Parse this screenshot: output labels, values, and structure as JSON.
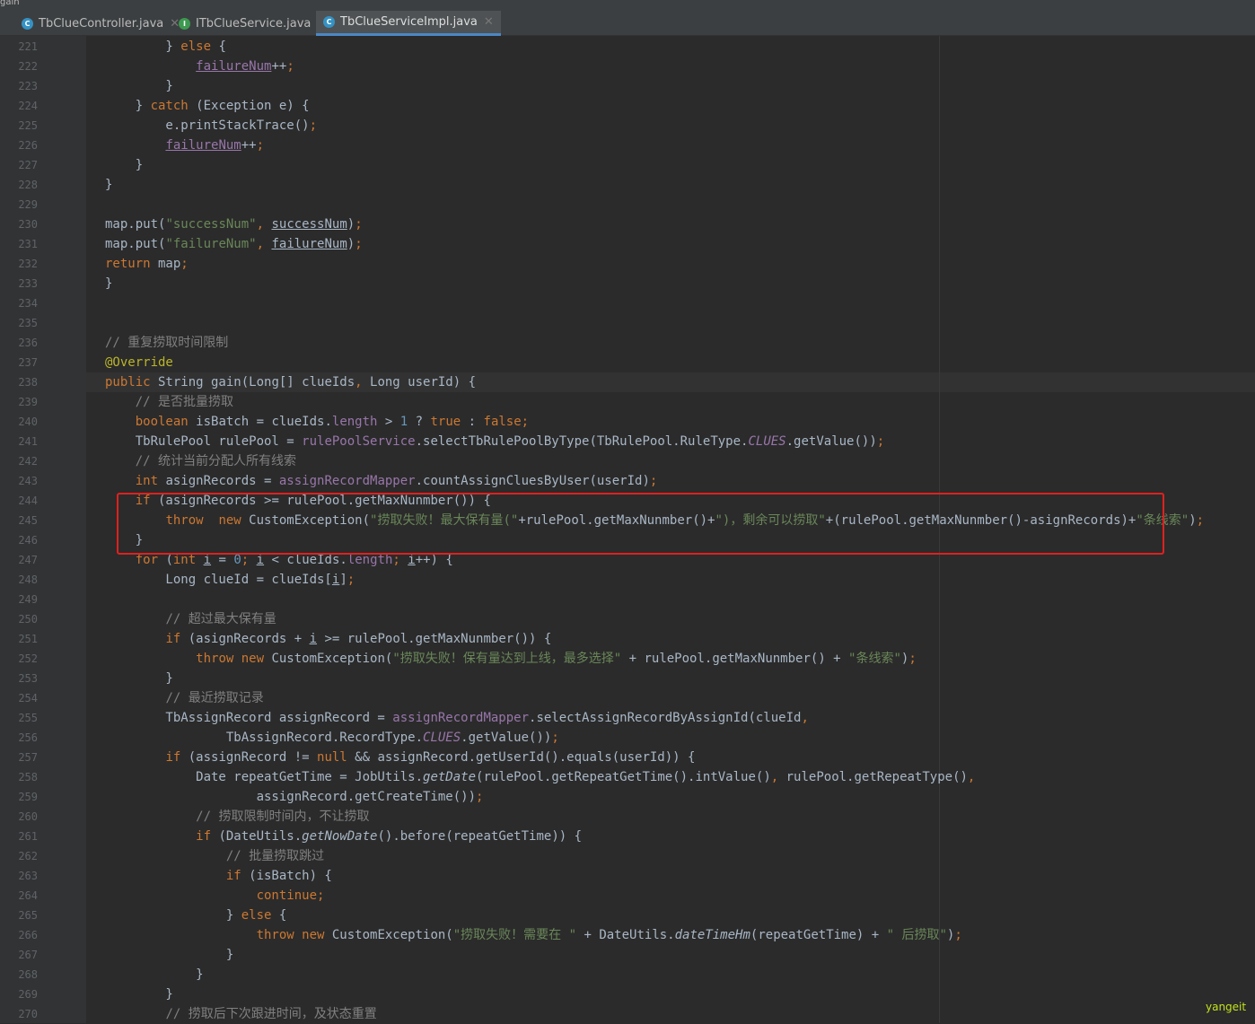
{
  "window": {
    "title": "gain"
  },
  "tabs": [
    {
      "label": "TbClueController.java",
      "icon": "C"
    },
    {
      "label": "ITbClueService.java",
      "icon": "I"
    },
    {
      "label": "TbClueServiceImpl.java",
      "icon": "C"
    }
  ],
  "line_numbers": "221\n222\n223\n224\n225\n226\n227\n228\n229\n230\n231\n232\n233\n234\n235\n236\n237\n238\n239\n240\n241\n242\n243\n244\n245\n246\n247\n248\n249\n250\n251\n252\n253\n254\n255\n256\n257\n258\n259\n260\n261\n262\n263\n264\n265\n266\n267\n268\n269\n270",
  "watermark": "yangeit"
}
